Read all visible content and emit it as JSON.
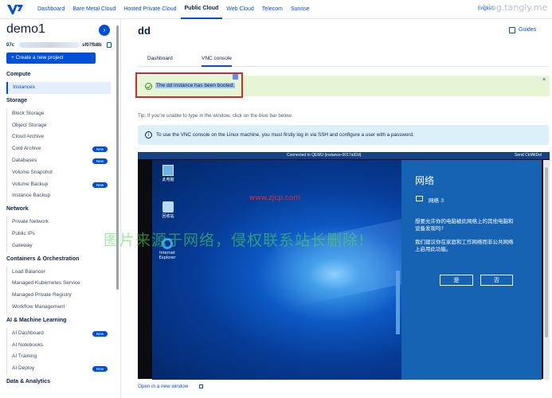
{
  "topnav": {
    "items": [
      "Dashboard",
      "Bare Metal Cloud",
      "Hosted Private Cloud",
      "Public Cloud",
      "Web Cloud",
      "Telecom",
      "Sunrise"
    ],
    "active_index": 3,
    "language": "English",
    "watermark": "blog.tangly.me"
  },
  "sidebar": {
    "project_name": "demo1",
    "project_id_start": "07c",
    "project_id_end": "sf07fb8b",
    "create_label": "+ Create a new project",
    "sections": [
      {
        "title": "Compute",
        "items": [
          {
            "label": "Instances",
            "active": true
          }
        ]
      },
      {
        "title": "Storage",
        "items": [
          {
            "label": "Block Storage"
          },
          {
            "label": "Object Storage"
          },
          {
            "label": "Cloud Archive"
          },
          {
            "label": "Cold Archive",
            "badge": "New"
          },
          {
            "label": "Databases",
            "badge": "New"
          },
          {
            "label": "Volume Snapshot"
          },
          {
            "label": "Volume Backup",
            "badge": "New"
          },
          {
            "label": "Instance Backup"
          }
        ]
      },
      {
        "title": "Network",
        "items": [
          {
            "label": "Private Network"
          },
          {
            "label": "Public IPs"
          },
          {
            "label": "Gateway"
          }
        ]
      },
      {
        "title": "Containers & Orchestration",
        "items": [
          {
            "label": "Load Balancer"
          },
          {
            "label": "Managed Kubernetes Service"
          },
          {
            "label": "Managed Private Registry"
          },
          {
            "label": "Workflow Management"
          }
        ]
      },
      {
        "title": "AI & Machine Learning",
        "items": [
          {
            "label": "AI Dashboard",
            "badge": "New"
          },
          {
            "label": "AI Notebooks"
          },
          {
            "label": "AI Training"
          },
          {
            "label": "AI Deploy",
            "badge": "New"
          }
        ]
      },
      {
        "title": "Data & Analytics",
        "items": []
      }
    ]
  },
  "main": {
    "title": "dd",
    "guides_label": "Guides",
    "tabs": [
      "Dashboard",
      "VNC console"
    ],
    "active_tab": 1,
    "alert": "The dd instance has been booted.",
    "alert_close": "×",
    "tip": "Tip: If you're unable to type in the window, click on the blue bar below.",
    "info": "To use the VNC console on the Linux machine, you must firstly log in via SSH and configure a user with a password.",
    "open_link": "Open in a new window"
  },
  "vnc": {
    "status": "Connected to QEMU (instance-0017a92d)",
    "send_label": "Send CtrlAltDel",
    "desktop_icons": [
      "此电脑",
      "回收站",
      "Internet Explorer"
    ],
    "network_panel": {
      "title": "网络",
      "network_name": "网络 3",
      "question": "想要允许你的电脑被此网络上的其他电脑和设备发现吗?",
      "recommendation": "我们建议你在家庭和工作网络而非公共网络上启用此功能。",
      "yes_label": "是",
      "no_label": "否"
    }
  },
  "overlays": {
    "site_watermark": "www.zjcp.com",
    "cn_watermark": "图片来源于网络，侵权联系站长删除!"
  },
  "colors": {
    "accent": "#0050d7",
    "success_bg": "#e6f5d4",
    "info_bg": "#dcf0fa",
    "vnc_bar": "#154285",
    "highlight_border": "#d02a2a"
  }
}
